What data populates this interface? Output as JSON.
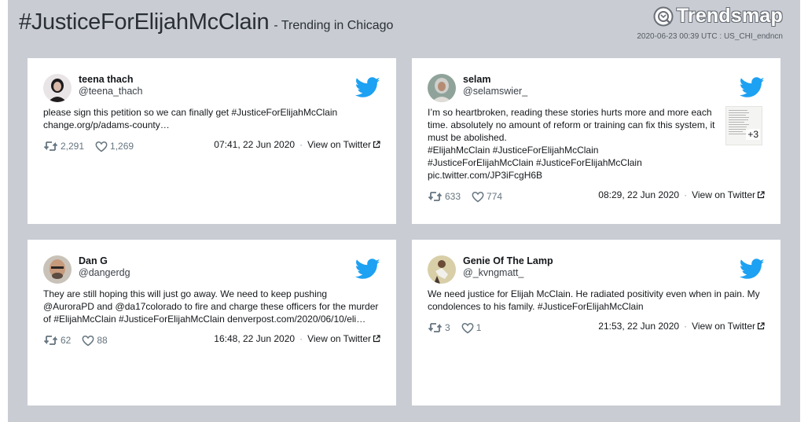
{
  "header": {
    "hashtag": "#JusticeForElijahMcClain",
    "subtitle": "- Trending in Chicago",
    "brand": "Trendsmap",
    "meta": "2020-06-23 00:39 UTC : US_CHI_endncn"
  },
  "colors": {
    "twitter_blue": "#1da1f2",
    "background": "#c9ccd3",
    "card": "#ffffff"
  },
  "tweets": [
    {
      "name": "teena thach ⁣",
      "handle": "@teena_thach",
      "lines": [
        "please sign this petition so we can finally get #JusticeForElijahMcClain",
        "change.org/p/adams-county…"
      ],
      "retweets": "2,291",
      "likes": "1,269",
      "timestamp": "07:41, 22 Jun 2020",
      "view_link": "View on Twitter"
    },
    {
      "name": "selam⁣",
      "handle": "@selamswier_",
      "lines": [
        "I’m so heartbroken, reading these stories hurts more and more each",
        "time. absolutely no amount of reform or training can fix this system, it",
        "must be abolished.",
        "#ElijahMcClain #JusticeForElijahMcClain",
        "#JusticeForElijahMcClain #JusticeForElijahMcClain",
        "pic.twitter.com/JP3iFcgH6B"
      ],
      "media_more": "+3",
      "retweets": "633",
      "likes": "774",
      "timestamp": "08:29, 22 Jun 2020",
      "view_link": "View on Twitter"
    },
    {
      "name": "Dan G",
      "handle": "@dangerdg",
      "lines": [
        "They are still hoping this will just go away. We need to keep pushing",
        "@AuroraPD and @da17colorado to fire and charge these officers for the murder",
        "of #ElijahMcClain #JusticeForElijahMcClain denverpost.com/2020/06/10/eli…"
      ],
      "retweets": "62",
      "likes": "88",
      "timestamp": "16:48, 22 Jun 2020",
      "view_link": "View on Twitter"
    },
    {
      "name": "Genie Of The Lamp⁣",
      "handle": "@_kvngmatt_",
      "lines": [
        "We need justice for Elijah McClain. He radiated positivity even when in pain. My",
        "condolences to his family. #JusticeForElijahMcClain"
      ],
      "retweets": "3",
      "likes": "1",
      "timestamp": "21:53, 22 Jun 2020",
      "view_link": "View on Twitter"
    }
  ],
  "icons": {
    "brand": "trendsmap-logo-icon",
    "bird": "twitter-bird-icon",
    "retweet": "retweet-icon",
    "like": "heart-icon",
    "external": "external-link-icon"
  }
}
